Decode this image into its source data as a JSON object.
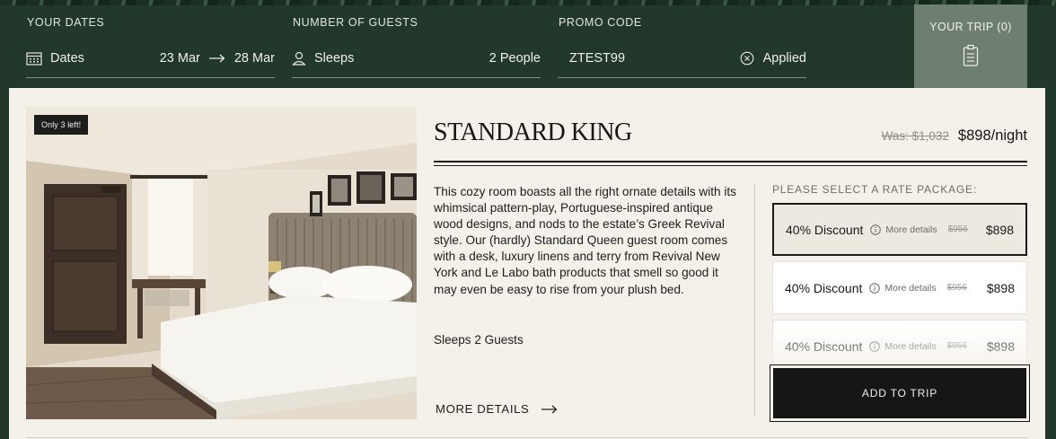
{
  "booking_bar": {
    "dates": {
      "label": "YOUR DATES",
      "field_label": "Dates",
      "check_in": "23 Mar",
      "check_out": "28 Mar",
      "icon": "calendar-icon"
    },
    "guests": {
      "label": "NUMBER OF GUESTS",
      "field_label": "Sleeps",
      "value": "2 People",
      "icon": "person-icon"
    },
    "promo": {
      "label": "PROMO CODE",
      "value": "ZTEST99",
      "status": "Applied",
      "icon": "clear-circle-icon"
    },
    "trip": {
      "label": "YOUR TRIP (0)",
      "icon": "clipboard-icon"
    }
  },
  "room": {
    "badge": "Only 3 left!",
    "title": "STANDARD KING",
    "was_price": "Was: $1,032",
    "price": "$898/night",
    "description": "This cozy room boasts all the right ornate details with its whimsical pattern-play, Portuguese-inspired antique wood designs, and nods to the estate’s Greek Revival style. Our (hardly) Standard Queen guest room comes with a desk, luxury linens and terry from Revival New York and Le Labo bath products that smell so good it may even be easy to rise from your plush bed.",
    "sleeps": "Sleeps 2 Guests",
    "more_details": "MORE DETAILS"
  },
  "rates": {
    "label": "PLEASE SELECT A RATE PACKAGE:",
    "packages": [
      {
        "name": "40% Discount",
        "info": "More details",
        "old": "$956",
        "price": "$898",
        "selected": true
      },
      {
        "name": "40% Discount",
        "info": "More details",
        "old": "$956",
        "price": "$898",
        "selected": false
      },
      {
        "name": "40% Discount",
        "info": "More details",
        "old": "$956",
        "price": "$898",
        "selected": false
      }
    ],
    "add_button": "ADD TO TRIP"
  },
  "colors": {
    "background": "#22382a",
    "card": "#f3f1ea",
    "trip_button": "#6e7f72",
    "dark": "#161616"
  }
}
